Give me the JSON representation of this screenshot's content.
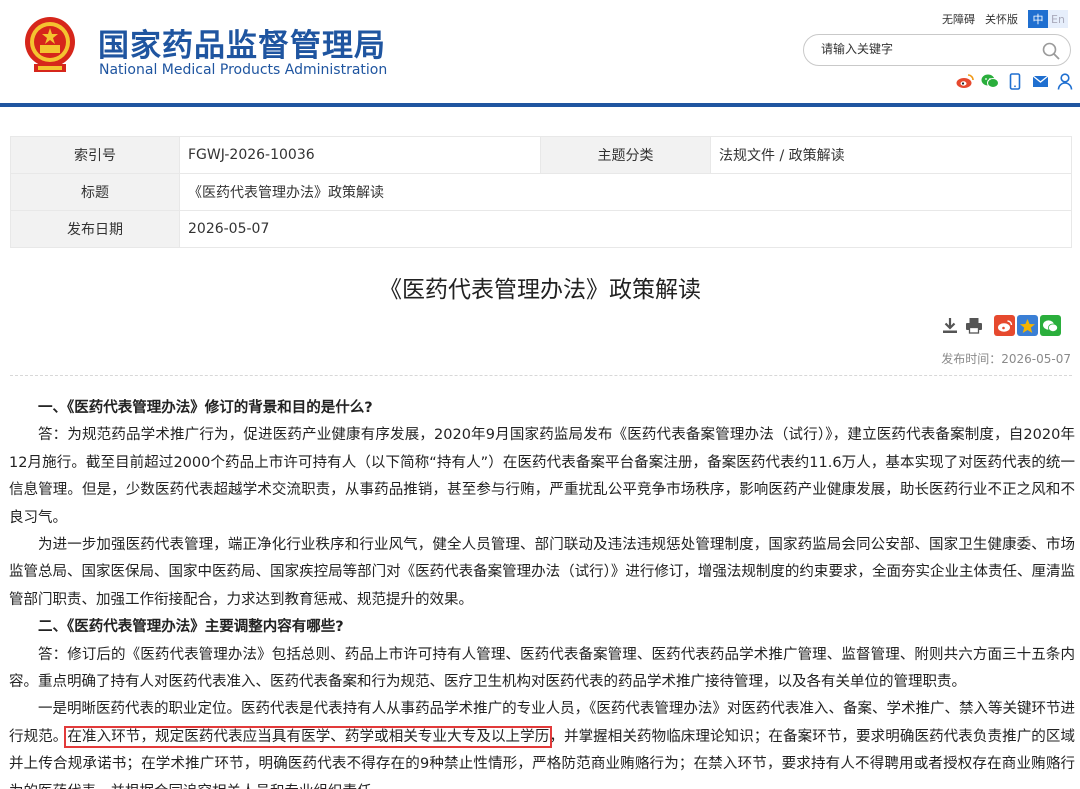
{
  "header": {
    "title_cn": "国家药品监督管理局",
    "title_en": "National Medical Products Administration",
    "accessibility_link": "无障碍",
    "elderly_link": "关怀版",
    "lang_zh": "中",
    "lang_en": "En",
    "search_placeholder": "请输入关键字"
  },
  "info_table": {
    "index_label": "索引号",
    "index_value": "FGWJ-2026-10036",
    "category_label": "主题分类",
    "category_value": "法规文件 / 政策解读",
    "title_label": "标题",
    "title_value": "《医药代表管理办法》政策解读",
    "date_label": "发布日期",
    "date_value": "2026-05-07"
  },
  "document": {
    "title": "《医药代表管理办法》政策解读",
    "publish_time": "发布时间：2026-05-07"
  },
  "article": {
    "q1": "一、《医药代表管理办法》修订的背景和目的是什么?",
    "p1": "答：为规范药品学术推广行为，促进医药产业健康有序发展，2020年9月国家药监局发布《医药代表备案管理办法（试行）》，建立医药代表备案制度，自2020年12月施行。截至目前超过2000个药品上市许可持有人（以下简称“持有人”）在医药代表备案平台备案注册，备案医药代表约11.6万人，基本实现了对医药代表的统一信息管理。但是，少数医药代表超越学术交流职责，从事药品推销，甚至参与行贿，严重扰乱公平竞争市场秩序，影响医药产业健康发展，助长医药行业不正之风和不良习气。",
    "p2": "为进一步加强医药代表管理，端正净化行业秩序和行业风气，健全人员管理、部门联动及违法违规惩处管理制度，国家药监局会同公安部、国家卫生健康委、市场监管总局、国家医保局、国家中医药局、国家疾控局等部门对《医药代表备案管理办法（试行）》进行修订，增强法规制度的约束要求，全面夯实企业主体责任、厘清监管部门职责、加强工作衔接配合，力求达到教育惩戒、规范提升的效果。",
    "q2": "二、《医药代表管理办法》主要调整内容有哪些?",
    "p3": "答：修订后的《医药代表管理办法》包括总则、药品上市许可持有人管理、医药代表备案管理、医药代表药品学术推广管理、监督管理、附则共六方面三十五条内容。重点明确了持有人对医药代表准入、医药代表备案和行为规范、医疗卫生机构对医药代表的药品学术推广接待管理，以及各有关单位的管理职责。",
    "p4_before": "一是明晰医药代表的职业定位。医药代表是代表持有人从事药品学术推广的专业人员，《医药代表管理办法》对医药代表准入、备案、学术推广、禁入等关键环节进行规范。",
    "p4_highlight": "在准入环节，规定医药代表应当具有医学、药学或相关专业大专及以上学历",
    "p4_after": "，并掌握相关药物临床理论知识；在备案环节，要求明确医药代表负责推广的区域并上传合规承诺书；在学术推广环节，明确医药代表不得存在的9种禁止性情形，严格防范商业贿赂行为；在禁入环节，要求持有人不得聘用或者授权存在商业贿赂行为的医药代表，并根据合同追究相关人员和专业组织责任。"
  },
  "colors": {
    "brand_blue": "#1f55a0",
    "highlight_red": "#e23a3a",
    "weibo_red": "#e6492e",
    "wechat_green": "#2aae3c",
    "star_gold": "#f5b400"
  },
  "icons": [
    "emblem-icon",
    "search-icon",
    "weibo-icon",
    "wechat-icon",
    "mobile-icon",
    "mail-icon",
    "user-icon",
    "download-icon",
    "print-icon",
    "share-weibo-icon",
    "share-qzone-icon",
    "share-wechat-icon"
  ]
}
